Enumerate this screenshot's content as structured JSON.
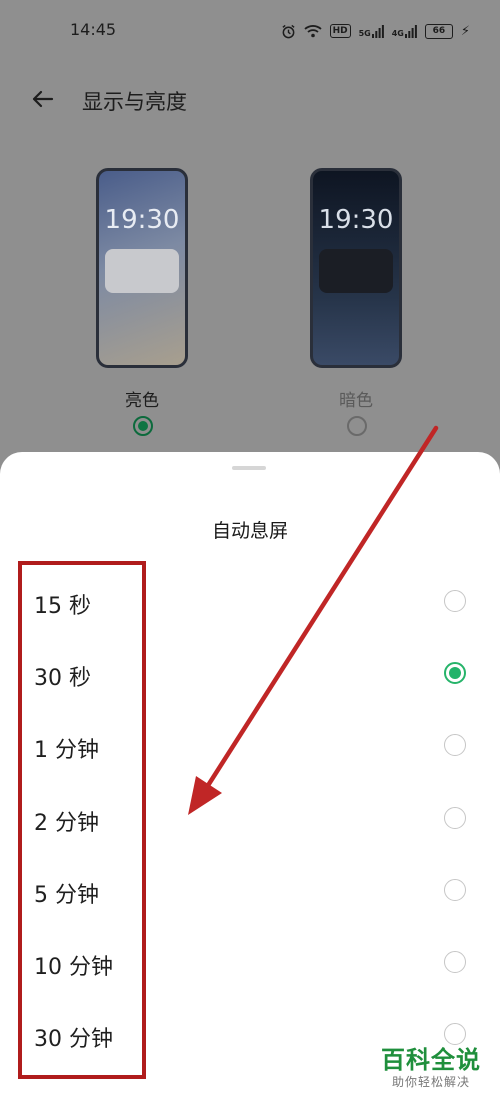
{
  "status_bar": {
    "time": "14:45",
    "hd": "HD",
    "net1": "5G",
    "net2": "4G",
    "battery": "66"
  },
  "header": {
    "title": "显示与亮度"
  },
  "theme": {
    "light": {
      "clock": "19:30",
      "label": "亮色",
      "selected": true
    },
    "dark": {
      "clock": "19:30",
      "label": "暗色",
      "selected": false
    }
  },
  "sheet": {
    "title": "自动息屏",
    "options": [
      {
        "label": "15 秒",
        "selected": false
      },
      {
        "label": "30 秒",
        "selected": true
      },
      {
        "label": "1 分钟",
        "selected": false
      },
      {
        "label": "2 分钟",
        "selected": false
      },
      {
        "label": "5 分钟",
        "selected": false
      },
      {
        "label": "10 分钟",
        "selected": false
      },
      {
        "label": "30 分钟",
        "selected": false
      }
    ]
  },
  "watermark": {
    "title": "百科全说",
    "subtitle": "助你轻松解决"
  },
  "colors": {
    "accent_green": "#22b36a",
    "annotation_red": "#b01c1c",
    "dim_overlay": "#8f8f8f"
  }
}
